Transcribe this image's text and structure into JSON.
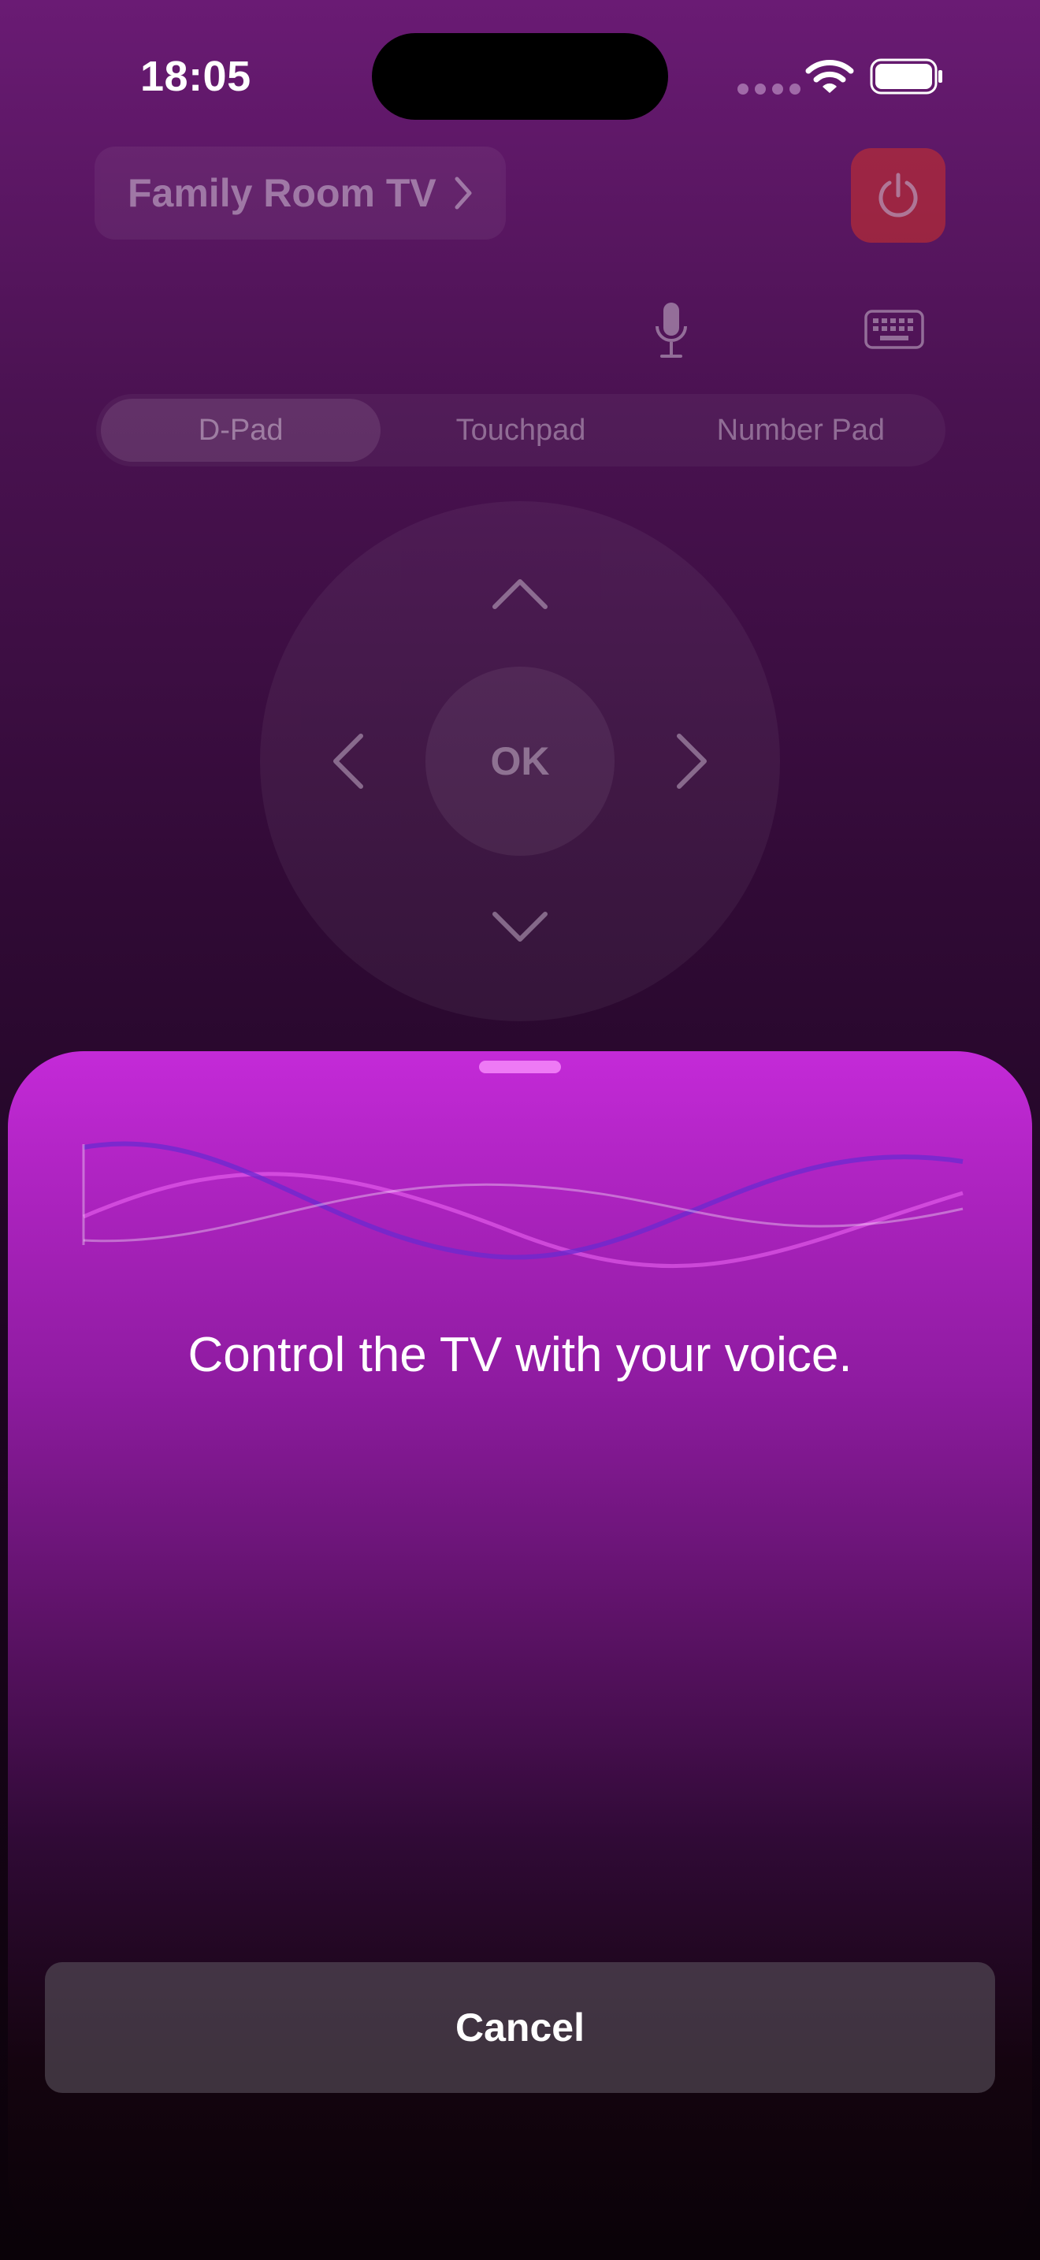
{
  "status_bar": {
    "time": "18:05"
  },
  "remote": {
    "device_name": "Family Room TV",
    "segments": [
      "D-Pad",
      "Touchpad",
      "Number Pad"
    ],
    "active_segment": "D-Pad",
    "ok_label": "OK",
    "power_color": "#d2322a"
  },
  "voice_sheet": {
    "prompt": "Control the TV with your voice.",
    "cancel_label": "Cancel",
    "accent_color": "#c42ad8"
  },
  "icons": [
    "wifi-icon",
    "battery-icon",
    "chevron-right-icon",
    "power-icon",
    "microphone-icon",
    "keyboard-icon",
    "chevron-up-icon",
    "chevron-down-icon",
    "chevron-left-icon",
    "waveform-icon"
  ]
}
